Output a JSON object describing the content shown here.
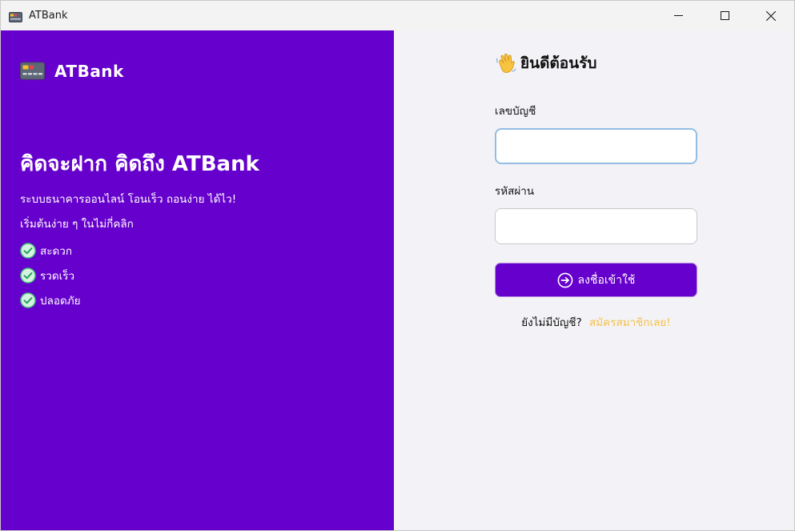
{
  "window": {
    "title": "ATBank",
    "controls": {
      "minimize": "minimize-icon",
      "maximize": "maximize-icon",
      "close": "close-icon"
    }
  },
  "colors": {
    "brand_purple": "#6600cc",
    "panel_bg": "#f3f3f7",
    "link_yellow": "#f5c04a",
    "focus_border": "#93bde3",
    "check_green": "#2db84d"
  },
  "left": {
    "brand_icon": "credit-card-icon",
    "brand_name": "ATBank",
    "headline": "คิดจะฝาก คิดถึง ATBank",
    "subline1": "ระบบธนาคารออนไลน์ โอนเร็ว ถอนง่าย ได้ไว!",
    "subline2": "เริ่มต้นง่าย ๆ ในไม่กี่คลิก",
    "features": [
      {
        "icon": "check-mark-icon",
        "label": "สะดวก"
      },
      {
        "icon": "check-mark-icon",
        "label": "รวดเร็ว"
      },
      {
        "icon": "check-mark-icon",
        "label": "ปลอดภัย"
      }
    ]
  },
  "form": {
    "welcome_icon": "waving-hand-icon",
    "welcome": "ยินดีต้อนรับ",
    "account_label": "เลขบัญชี",
    "account_value": "",
    "password_label": "รหัสผ่าน",
    "password_value": "",
    "login_icon": "arrow-right-circle-icon",
    "login_label": "ลงชื่อเข้าใช้",
    "signup_prompt": "ยังไม่มีบัญชี?",
    "signup_link": "สมัครสมาชิกเลย!"
  }
}
